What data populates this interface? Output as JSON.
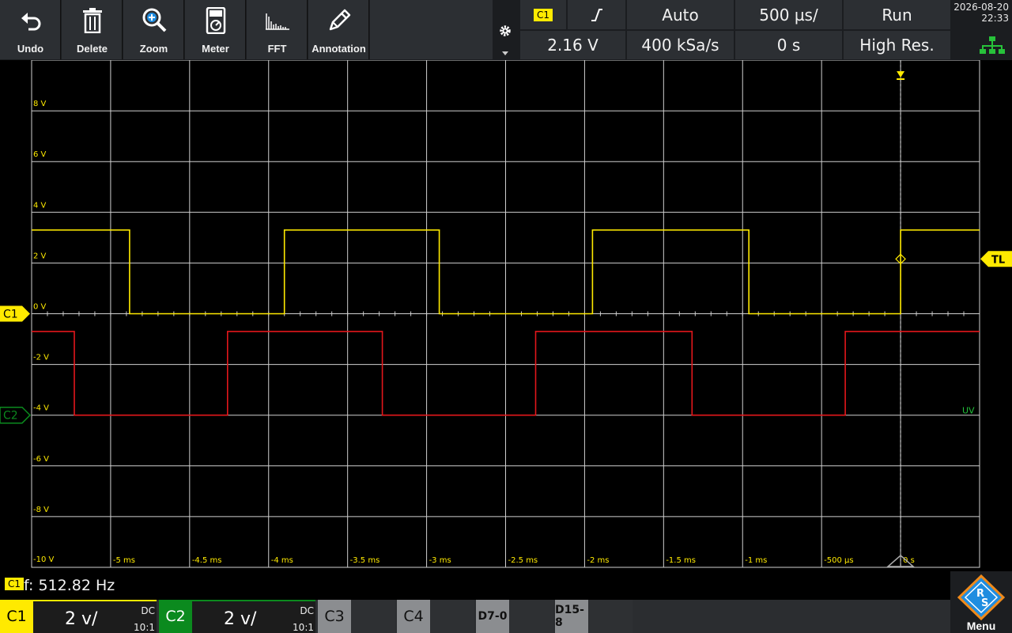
{
  "toolbar": {
    "buttons": [
      {
        "label": "Undo",
        "icon": "undo-icon"
      },
      {
        "label": "Delete",
        "icon": "trash-icon"
      },
      {
        "label": "Zoom",
        "icon": "zoom-icon"
      },
      {
        "label": "Meter",
        "icon": "meter-icon"
      },
      {
        "label": "FFT",
        "icon": "fft-icon"
      },
      {
        "label": "Annotation",
        "icon": "pencil-icon"
      }
    ]
  },
  "acquisition": {
    "trigger_source": "C1",
    "trigger_slope": "rising-edge",
    "trigger_mode": "Auto",
    "timebase": "500 µs/",
    "run_state": "Run",
    "trigger_level": "2.16 V",
    "sample_rate": "400 kSa/s",
    "horizontal_position": "0 s",
    "acq_mode": "High Res."
  },
  "datetime": {
    "date": "2026-08-20",
    "time": "22:33"
  },
  "grid": {
    "y_labels": [
      "8 V",
      "6 V",
      "4 V",
      "2 V",
      "0 V",
      "-2 V",
      "-4 V",
      "-6 V",
      "-8 V",
      "-10 V"
    ],
    "x_labels": [
      "-5 ms",
      "-4.5 ms",
      "-4 ms",
      "-3.5 ms",
      "-3 ms",
      "-2.5 ms",
      "-2 ms",
      "-1.5 ms",
      "-1 ms",
      "-500 µs",
      "0 s"
    ]
  },
  "markers": {
    "c1": "C1",
    "c2": "C2",
    "trigger_level": "TL",
    "uv": "UV"
  },
  "chart_data": {
    "type": "line",
    "x_unit": "ms",
    "y_unit": "V",
    "xlim": [
      -5.5,
      0.5
    ],
    "ylim": [
      -10,
      10
    ],
    "series": [
      {
        "name": "C1",
        "color": "#ffea00",
        "points": [
          [
            -5.5,
            3.3
          ],
          [
            -4.88,
            3.3
          ],
          [
            -4.88,
            0.0
          ],
          [
            -3.9,
            0.0
          ],
          [
            -3.9,
            3.3
          ],
          [
            -2.92,
            3.3
          ],
          [
            -2.92,
            0.0
          ],
          [
            -1.95,
            0.0
          ],
          [
            -1.95,
            3.3
          ],
          [
            -0.96,
            3.3
          ],
          [
            -0.96,
            0.0
          ],
          [
            0.0,
            0.0
          ],
          [
            0.0,
            3.3
          ],
          [
            0.5,
            3.3
          ]
        ]
      },
      {
        "name": "C2",
        "color": "#e3171b",
        "points": [
          [
            -5.5,
            -0.7
          ],
          [
            -5.23,
            -0.7
          ],
          [
            -5.23,
            -4.0
          ],
          [
            -4.26,
            -4.0
          ],
          [
            -4.26,
            -0.7
          ],
          [
            -3.28,
            -0.7
          ],
          [
            -3.28,
            -4.0
          ],
          [
            -2.31,
            -4.0
          ],
          [
            -2.31,
            -0.7
          ],
          [
            -1.32,
            -0.7
          ],
          [
            -1.32,
            -4.0
          ],
          [
            -0.35,
            -4.0
          ],
          [
            -0.35,
            -0.7
          ],
          [
            0.5,
            -0.7
          ]
        ]
      }
    ],
    "trigger_level_v": 2.16
  },
  "measurement": {
    "badge": "C1",
    "text": "f: 512.82 Hz"
  },
  "channels": [
    {
      "name": "C1",
      "scale": "2 v/",
      "coupling": "DC",
      "probe": "10:1",
      "color": "#ffea00"
    },
    {
      "name": "C2",
      "scale": "2 v/",
      "coupling": "DC",
      "probe": "10:1",
      "color": "#0b8a1e"
    }
  ],
  "inactive_channels": [
    "C3",
    "C4",
    "D7-0",
    "D15-8"
  ],
  "menu": {
    "label": "Menu",
    "logo": "R&S"
  }
}
